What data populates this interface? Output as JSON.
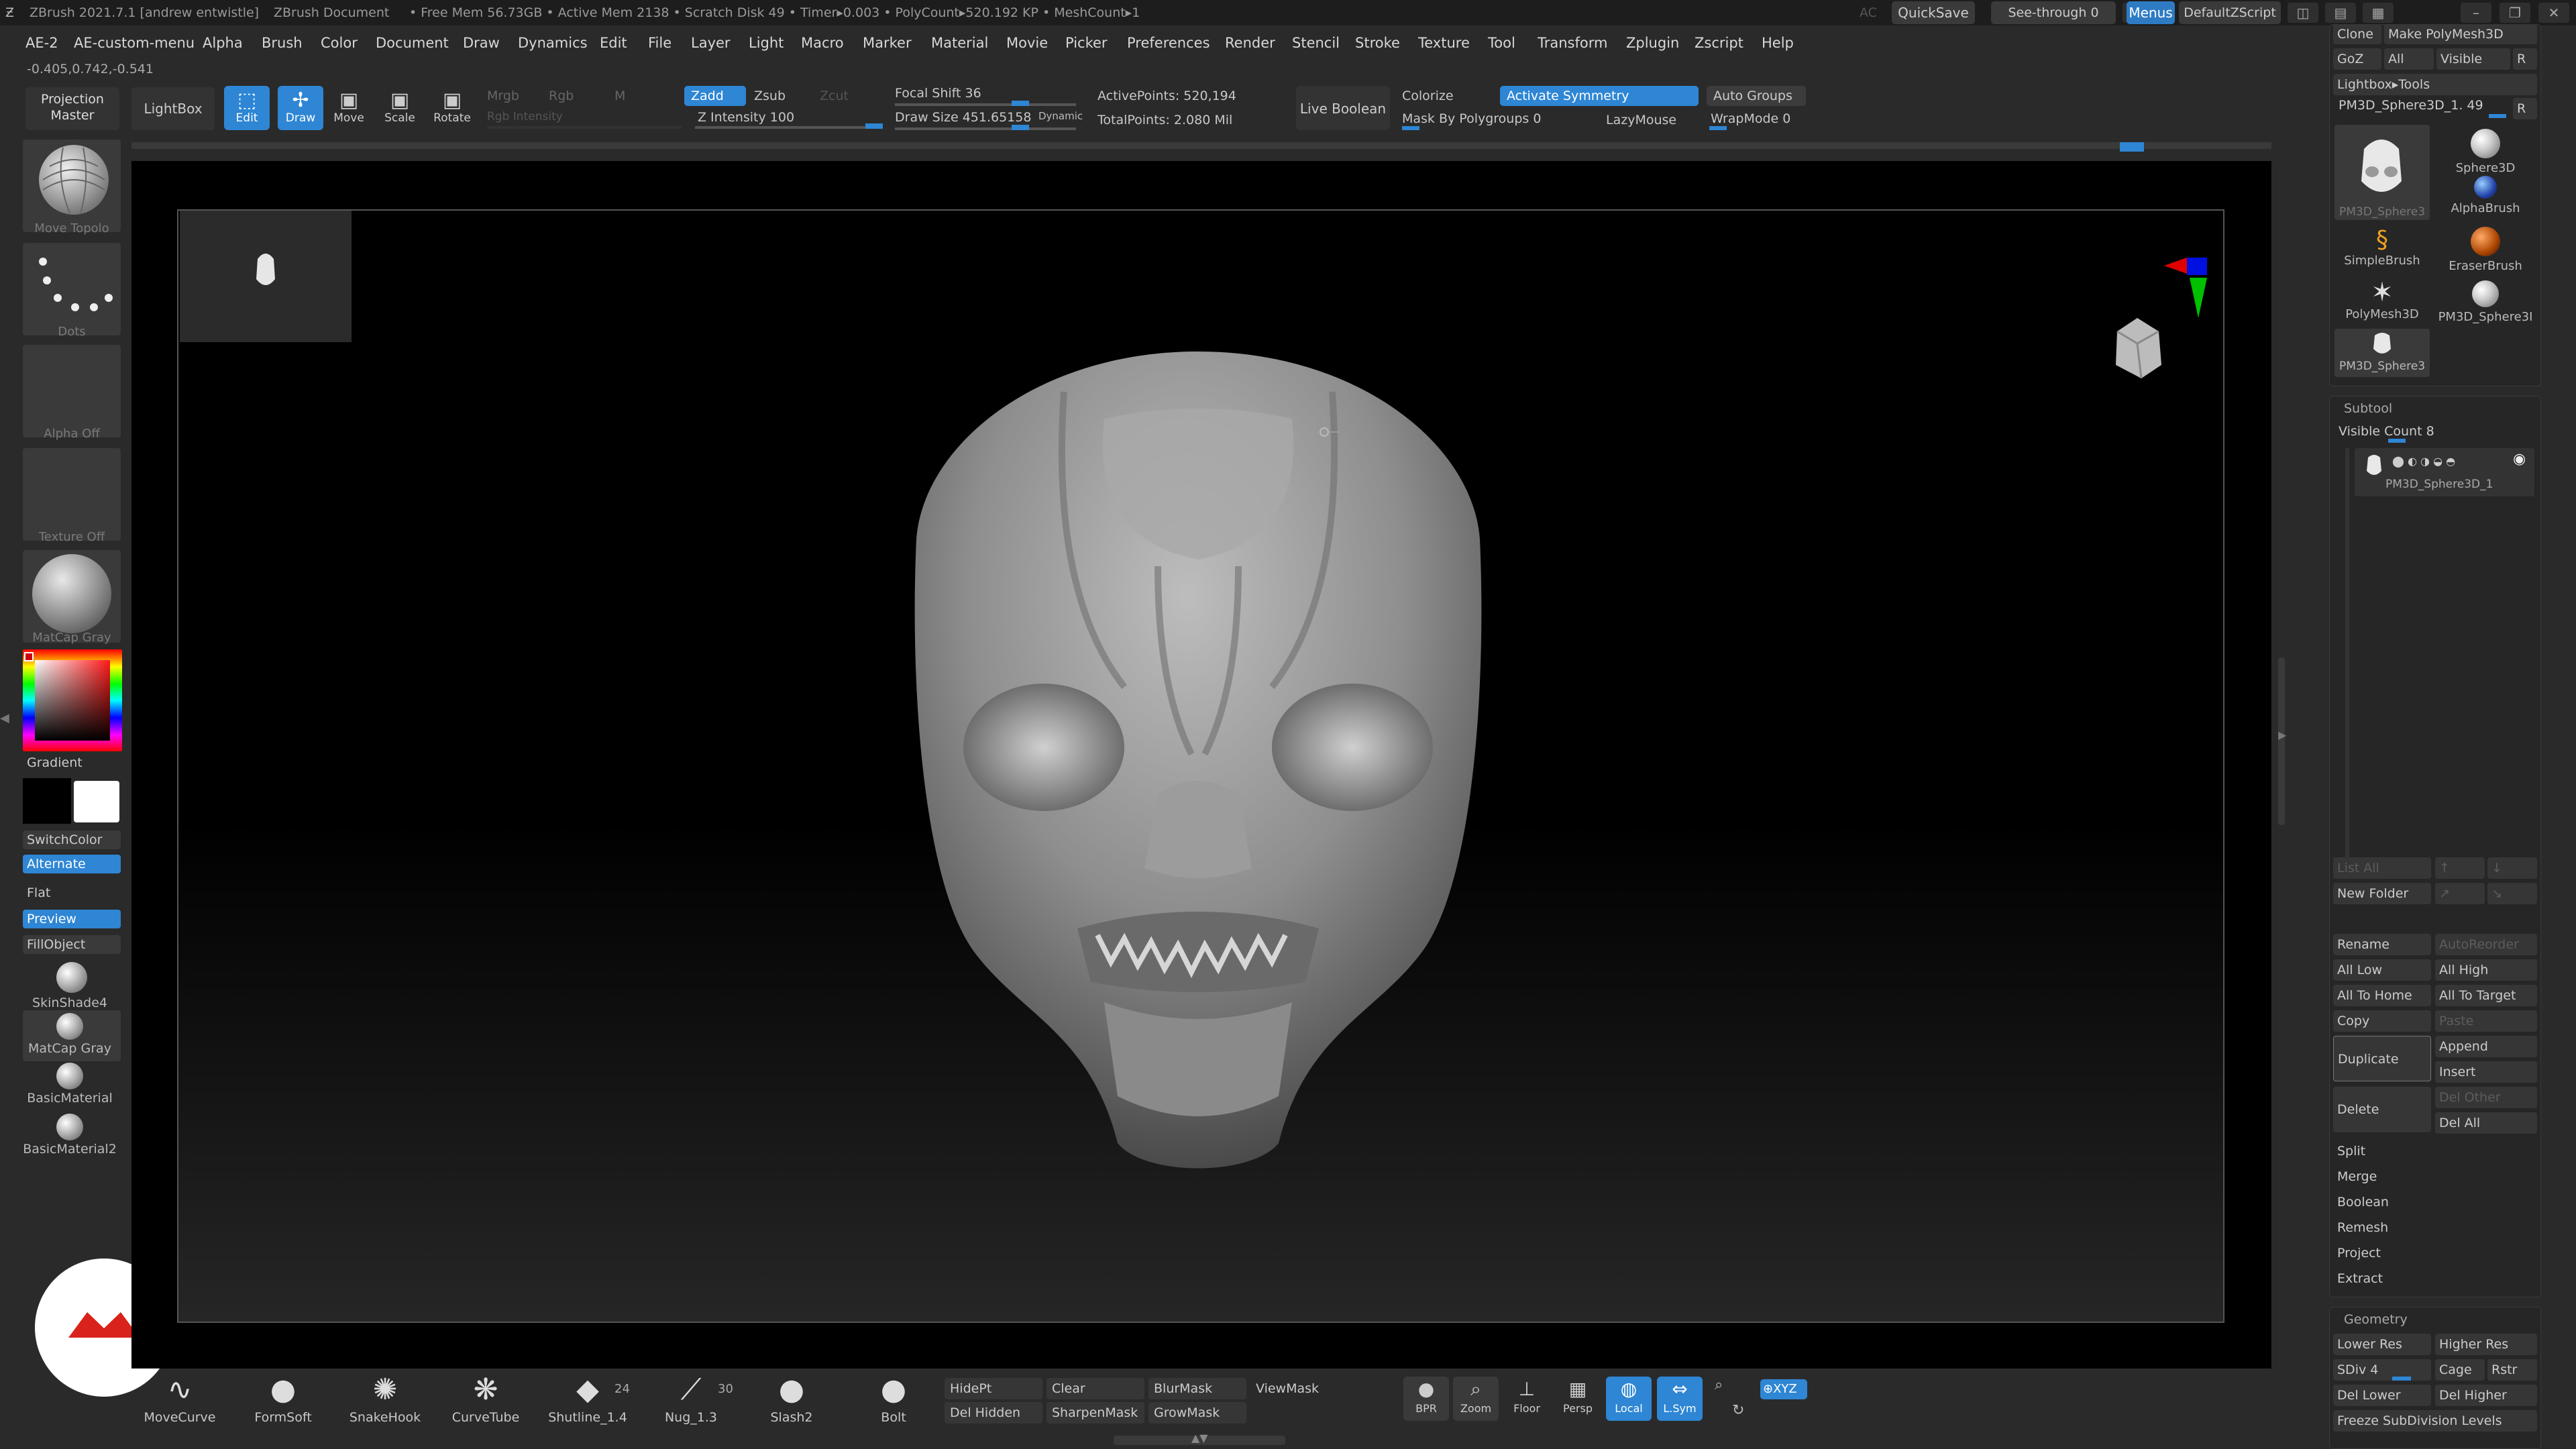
{
  "title_bar": {
    "app": "ZBrush 2021.7.1 [andrew entwistle]",
    "document": "ZBrush Document",
    "stats": "• Free Mem 56.73GB • Active Mem 2138 • Scratch Disk 49 • Timer▸0.003 • PolyCount▸520.192 KP • MeshCount▸1",
    "ac": "AC",
    "quicksave": "QuickSave",
    "see_through": "See-through  0",
    "menus": "Menus",
    "default_zscript": "DefaultZScript"
  },
  "menu_bar": [
    "AE-2",
    "AE-custom-menu",
    "Alpha",
    "Brush",
    "Color",
    "Document",
    "Draw",
    "Dynamics",
    "Edit",
    "File",
    "Layer",
    "Light",
    "Macro",
    "Marker",
    "Material",
    "Movie",
    "Picker",
    "Preferences",
    "Render",
    "Stencil",
    "Stroke",
    "Texture",
    "Tool",
    "Transform",
    "Zplugin",
    "Zscript",
    "Help"
  ],
  "coords": "-0.405,0.742,-0.541",
  "top_shelf": {
    "projection_master": "Projection Master",
    "lightbox": "LightBox",
    "edit": "Edit",
    "draw": "Draw",
    "move": "Move",
    "scale": "Scale",
    "rotate": "Rotate",
    "mrgb": "Mrgb",
    "rgb": "Rgb",
    "m": "M",
    "rgb_intensity": "Rgb Intensity",
    "zadd": "Zadd",
    "zsub": "Zsub",
    "zcut": "Zcut",
    "z_intensity": "Z Intensity 100",
    "focal_shift": "Focal Shift 36",
    "draw_size": "Draw Size 451.65158",
    "dynamic": "Dynamic",
    "active_points": "ActivePoints: 520,194",
    "total_points": "TotalPoints: 2.080 Mil",
    "live_boolean": "Live Boolean",
    "colorize": "Colorize",
    "activate_symmetry": "Activate Symmetry",
    "auto_groups": "Auto Groups",
    "mask_by_polygroups": "Mask By Polygroups 0",
    "lazymouse": "LazyMouse",
    "wrapmode": "WrapMode 0"
  },
  "left_palette": {
    "brush_label": "Move Topolo",
    "stroke_label": "Dots",
    "alpha_label": "Alpha Off",
    "texture_label": "Texture Off",
    "material_label": "MatCap Gray",
    "gradient": "Gradient",
    "switch_color": "SwitchColor",
    "alternate": "Alternate",
    "flat": "Flat",
    "preview": "Preview",
    "fill_object": "FillObject",
    "materials": [
      "SkinShade4",
      "MatCap Gray",
      "BasicMaterial",
      "BasicMaterial2"
    ]
  },
  "right_panel": {
    "clone": "Clone",
    "make_polymesh": "Make PolyMesh3D",
    "goz": "GoZ",
    "all": "All",
    "visible": "Visible",
    "r": "R",
    "lightbox_tools": "Lightbox▸Tools",
    "current_tool": "PM3D_Sphere3D_1. 49",
    "tools": [
      "PM3D_Sphere3",
      "Sphere3D",
      "AlphaBrush",
      "SimpleBrush",
      "EraserBrush",
      "PolyMesh3D",
      "PM3D_Sphere3I",
      "PM3D_Sphere3"
    ],
    "subtool": "Subtool",
    "visible_count": "Visible Count 8",
    "subtool_name": "PM3D_Sphere3D_1",
    "list_all": "List All",
    "new_folder": "New Folder",
    "rename": "Rename",
    "autoreorder": "AutoReorder",
    "all_low": "All Low",
    "all_high": "All High",
    "all_to_home": "All To Home",
    "all_to_target": "All To Target",
    "copy": "Copy",
    "paste": "Paste",
    "duplicate": "Duplicate",
    "append": "Append",
    "insert": "Insert",
    "delete": "Delete",
    "del_other": "Del Other",
    "del_all": "Del All",
    "split": "Split",
    "merge": "Merge",
    "boolean": "Boolean",
    "remesh": "Remesh",
    "project": "Project",
    "extract": "Extract",
    "geometry": "Geometry",
    "lower_res": "Lower Res",
    "higher_res": "Higher Res",
    "sdiv": "SDiv 4",
    "cage": "Cage",
    "rstr": "Rstr",
    "del_lower": "Del Lower",
    "del_higher": "Del Higher",
    "freeze_subdivision": "Freeze SubDivision Levels"
  },
  "bottom_shelf": {
    "brushes": [
      {
        "name": "MoveCurve",
        "icon": "∿"
      },
      {
        "name": "FormSoft",
        "icon": "●"
      },
      {
        "name": "SnakeHook",
        "icon": "✺"
      },
      {
        "name": "CurveTube",
        "icon": "❋"
      },
      {
        "name": "Shutline_1.4",
        "icon": "◆",
        "badge": "24"
      },
      {
        "name": "Nug_1.3",
        "icon": "⟋",
        "badge": "30"
      },
      {
        "name": "Slash2",
        "icon": "●"
      },
      {
        "name": "Bolt",
        "icon": "●"
      }
    ],
    "hidept": "HidePt",
    "clear": "Clear",
    "blurmask": "BlurMask",
    "viewmask": "ViewMask",
    "del_hidden": "Del Hidden",
    "sharpenmask": "SharpenMask",
    "growmask": "GrowMask",
    "bpr": "BPR",
    "zoom": "Zoom",
    "floor": "Floor",
    "persp": "Persp",
    "local": "Local",
    "lsym": "L.Sym",
    "xyz": "⊕XYZ"
  },
  "colors": {
    "accent": "#2e86d4",
    "background": "#2a2a2a",
    "canvas": "#000000"
  }
}
